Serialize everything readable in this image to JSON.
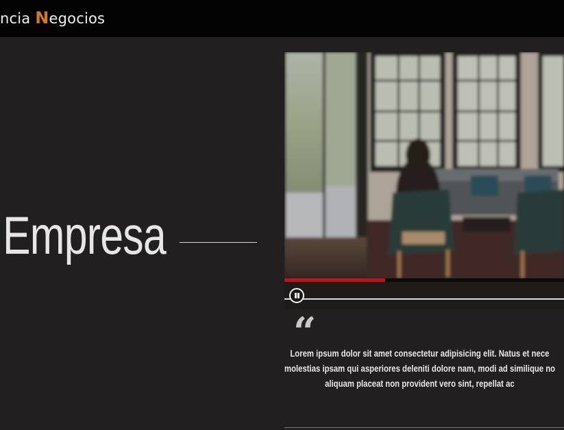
{
  "header": {
    "brand_prefix": "ncia ",
    "brand_accent_letter": "N",
    "brand_suffix": "egocios",
    "accent_color": "#d5781f"
  },
  "hero": {
    "title": "Empresa"
  },
  "video": {
    "progress": 0.36,
    "state": "playing",
    "progress_color": "#c4121b",
    "pause_icon": "pause-icon"
  },
  "testimonial": {
    "quote_icon": "“",
    "lines": [
      "Lorem ipsum dolor sit amet consectetur adipisicing elit. Natus et nece",
      "molestias ipsam qui asperiores deleniti dolore nam, modi ad similique no",
      "aliquam placeat non provident vero sint, repellat ac"
    ]
  }
}
